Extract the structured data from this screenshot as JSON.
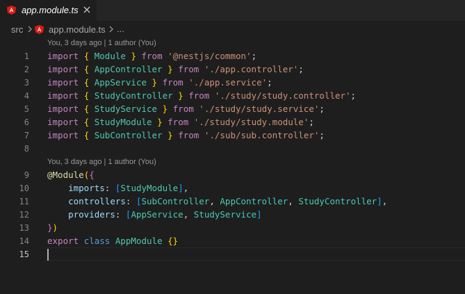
{
  "tab": {
    "title": "app.module.ts",
    "close_icon": "close-icon",
    "file_icon": "angular-icon"
  },
  "breadcrumb": {
    "folder": "src",
    "file": "app.module.ts",
    "more": "..."
  },
  "codelens": [
    "You, 3 days ago | 1 author (You)",
    "You, 3 days ago | 1 author (You)"
  ],
  "lines": [
    {
      "n": "1"
    },
    {
      "n": "2"
    },
    {
      "n": "3"
    },
    {
      "n": "4"
    },
    {
      "n": "5"
    },
    {
      "n": "6"
    },
    {
      "n": "7"
    },
    {
      "n": "8"
    },
    {
      "n": "9"
    },
    {
      "n": "10"
    },
    {
      "n": "11"
    },
    {
      "n": "12"
    },
    {
      "n": "13"
    },
    {
      "n": "14"
    },
    {
      "n": "15"
    }
  ],
  "code": {
    "l1": {
      "kw": "import",
      "open": "{",
      "name": "Module",
      "close": "}",
      "from": "from",
      "path": "'@nestjs/common'",
      "end": ";"
    },
    "l2": {
      "kw": "import",
      "open": "{",
      "name": "AppController",
      "close": "}",
      "from": "from",
      "path": "'./app.controller'",
      "end": ";"
    },
    "l3": {
      "kw": "import",
      "open": "{",
      "name": "AppService",
      "close": "}",
      "from": "from",
      "path": "'./app.service'",
      "end": ";"
    },
    "l4": {
      "kw": "import",
      "open": "{",
      "name": "StudyController",
      "close": "}",
      "from": "from",
      "path": "'./study/study.controller'",
      "end": ";"
    },
    "l5": {
      "kw": "import",
      "open": "{",
      "name": "StudyService",
      "close": "}",
      "from": "from",
      "path": "'./study/study.service'",
      "end": ";"
    },
    "l6": {
      "kw": "import",
      "open": "{",
      "name": "StudyModule",
      "close": "}",
      "from": "from",
      "path": "'./study/study.module'",
      "end": ";"
    },
    "l7": {
      "kw": "import",
      "open": "{",
      "name": "SubController",
      "close": "}",
      "from": "from",
      "path": "'./sub/sub.controller'",
      "end": ";"
    },
    "l9": {
      "at": "@",
      "decorator": "Module",
      "paren": "(",
      "brace": "{"
    },
    "l10": {
      "prop": "imports",
      "colon": ": ",
      "open": "[",
      "items": "StudyModule",
      "close": "]",
      "comma": ","
    },
    "l11": {
      "prop": "controllers",
      "colon": ": ",
      "open": "[",
      "a": "SubController",
      "b": "AppController",
      "c": "StudyController",
      "sep": ", ",
      "close": "]",
      "comma": ","
    },
    "l12": {
      "prop": "providers",
      "colon": ": ",
      "open": "[",
      "a": "AppService",
      "b": "StudyService",
      "sep": ", ",
      "close": "]"
    },
    "l13": {
      "brace": "}",
      "paren": ")"
    },
    "l14": {
      "export": "export",
      "cls": "class",
      "name": "AppModule",
      "body": "{}"
    }
  },
  "colors": {
    "background": "#1e1e1e",
    "keyword": "#c586c0",
    "keyword_blue": "#569cd6",
    "type": "#4ec9b0",
    "string": "#ce9178",
    "property": "#9cdcfe",
    "decorator": "#dcdcaa"
  }
}
